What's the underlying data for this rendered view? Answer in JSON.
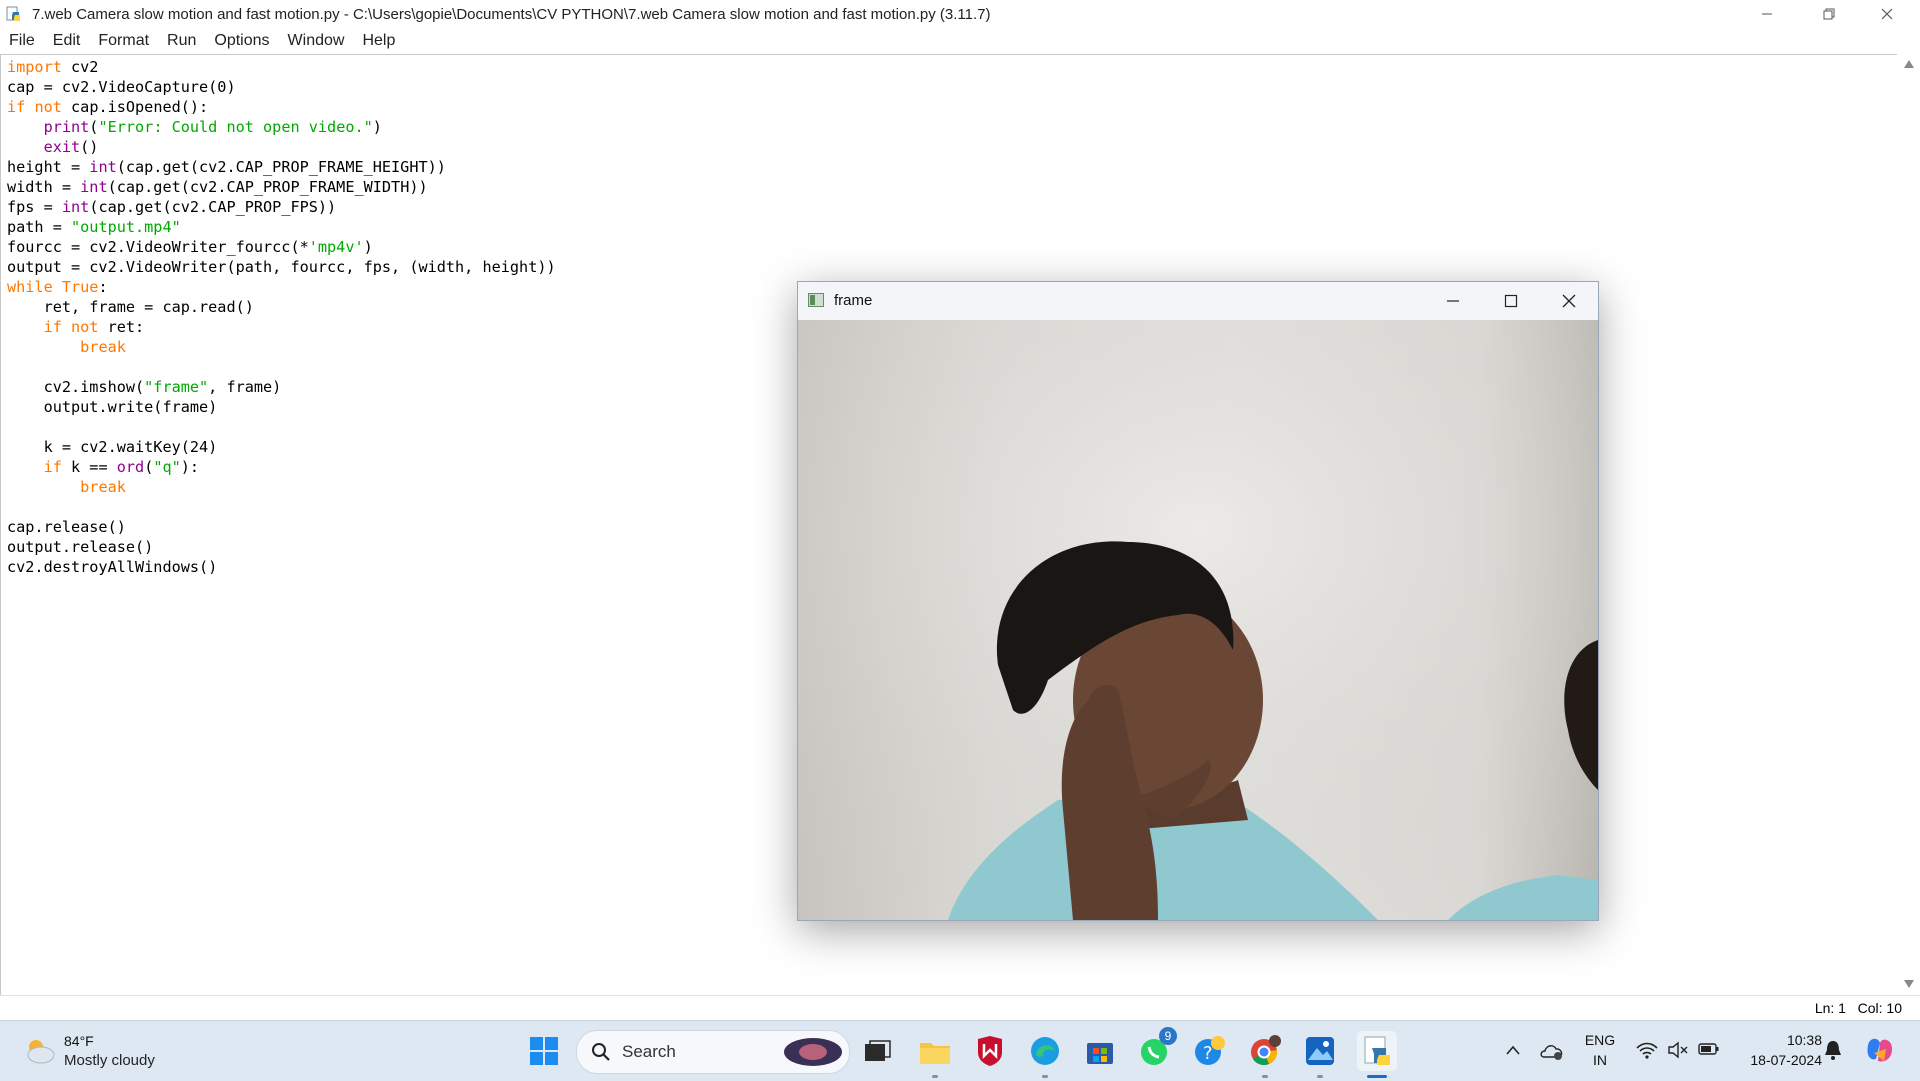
{
  "window": {
    "title": "7.web Camera slow motion and fast motion.py - C:\\Users\\gopie\\Documents\\CV PYTHON\\7.web Camera slow motion and fast motion.py (3.11.7)"
  },
  "menu": [
    "File",
    "Edit",
    "Format",
    "Run",
    "Options",
    "Window",
    "Help"
  ],
  "editor": {
    "lines": [
      [
        {
          "t": "import",
          "c": "kw"
        },
        {
          "t": " cv2",
          "c": ""
        }
      ],
      [
        {
          "t": "cap = cv2.VideoCapture(0)",
          "c": ""
        }
      ],
      [
        {
          "t": "if",
          "c": "kw"
        },
        {
          "t": " ",
          "c": ""
        },
        {
          "t": "not",
          "c": "kw"
        },
        {
          "t": " cap.isOpened():",
          "c": ""
        }
      ],
      [
        {
          "t": "    ",
          "c": ""
        },
        {
          "t": "print",
          "c": "bi"
        },
        {
          "t": "(",
          "c": ""
        },
        {
          "t": "\"Error: Could not open video.\"",
          "c": "st"
        },
        {
          "t": ")",
          "c": ""
        }
      ],
      [
        {
          "t": "    ",
          "c": ""
        },
        {
          "t": "exit",
          "c": "bi"
        },
        {
          "t": "()",
          "c": ""
        }
      ],
      [
        {
          "t": "height = ",
          "c": ""
        },
        {
          "t": "int",
          "c": "bi"
        },
        {
          "t": "(cap.get(cv2.CAP_PROP_FRAME_HEIGHT))",
          "c": ""
        }
      ],
      [
        {
          "t": "width = ",
          "c": ""
        },
        {
          "t": "int",
          "c": "bi"
        },
        {
          "t": "(cap.get(cv2.CAP_PROP_FRAME_WIDTH))",
          "c": ""
        }
      ],
      [
        {
          "t": "fps = ",
          "c": ""
        },
        {
          "t": "int",
          "c": "bi"
        },
        {
          "t": "(cap.get(cv2.CAP_PROP_FPS))",
          "c": ""
        }
      ],
      [
        {
          "t": "path = ",
          "c": ""
        },
        {
          "t": "\"output.mp4\"",
          "c": "st"
        }
      ],
      [
        {
          "t": "fourcc = cv2.VideoWriter_fourcc(*",
          "c": ""
        },
        {
          "t": "'mp4v'",
          "c": "st"
        },
        {
          "t": ")",
          "c": ""
        }
      ],
      [
        {
          "t": "output = cv2.VideoWriter(path, fourcc, fps, (width, height))",
          "c": ""
        }
      ],
      [
        {
          "t": "while",
          "c": "kw"
        },
        {
          "t": " ",
          "c": ""
        },
        {
          "t": "True",
          "c": "kw"
        },
        {
          "t": ":",
          "c": ""
        }
      ],
      [
        {
          "t": "    ret, frame = cap.read()",
          "c": ""
        }
      ],
      [
        {
          "t": "    ",
          "c": ""
        },
        {
          "t": "if",
          "c": "kw"
        },
        {
          "t": " ",
          "c": ""
        },
        {
          "t": "not",
          "c": "kw"
        },
        {
          "t": " ret:",
          "c": ""
        }
      ],
      [
        {
          "t": "        ",
          "c": ""
        },
        {
          "t": "break",
          "c": "kw"
        }
      ],
      [
        {
          "t": "",
          "c": ""
        }
      ],
      [
        {
          "t": "    cv2.imshow(",
          "c": ""
        },
        {
          "t": "\"frame\"",
          "c": "st"
        },
        {
          "t": ", frame)",
          "c": ""
        }
      ],
      [
        {
          "t": "    output.write(frame)",
          "c": ""
        }
      ],
      [
        {
          "t": "",
          "c": ""
        }
      ],
      [
        {
          "t": "    k = cv2.waitKey(24)",
          "c": ""
        }
      ],
      [
        {
          "t": "    ",
          "c": ""
        },
        {
          "t": "if",
          "c": "kw"
        },
        {
          "t": " k == ",
          "c": ""
        },
        {
          "t": "ord",
          "c": "bi"
        },
        {
          "t": "(",
          "c": ""
        },
        {
          "t": "\"q\"",
          "c": "st"
        },
        {
          "t": "):",
          "c": ""
        }
      ],
      [
        {
          "t": "        ",
          "c": ""
        },
        {
          "t": "break",
          "c": "kw"
        }
      ],
      [
        {
          "t": "",
          "c": ""
        }
      ],
      [
        {
          "t": "cap.release()",
          "c": ""
        }
      ],
      [
        {
          "t": "output.release()",
          "c": ""
        }
      ],
      [
        {
          "t": "cv2.destroyAllWindows()",
          "c": ""
        }
      ]
    ]
  },
  "status": {
    "ln": "Ln: 1",
    "col": "Col: 10"
  },
  "frame_window": {
    "title": "frame"
  },
  "taskbar": {
    "weather_temp": "84°F",
    "weather_desc": "Mostly cloudy",
    "search_label": "Search",
    "whatsapp_badge": "9",
    "lang_top": "ENG",
    "lang_bottom": "IN",
    "time": "10:38",
    "date": "18-07-2024"
  },
  "colors": {
    "keyword": "#ff7700",
    "builtin": "#900090",
    "string": "#00aa00",
    "taskbar": "#dde8f2"
  }
}
